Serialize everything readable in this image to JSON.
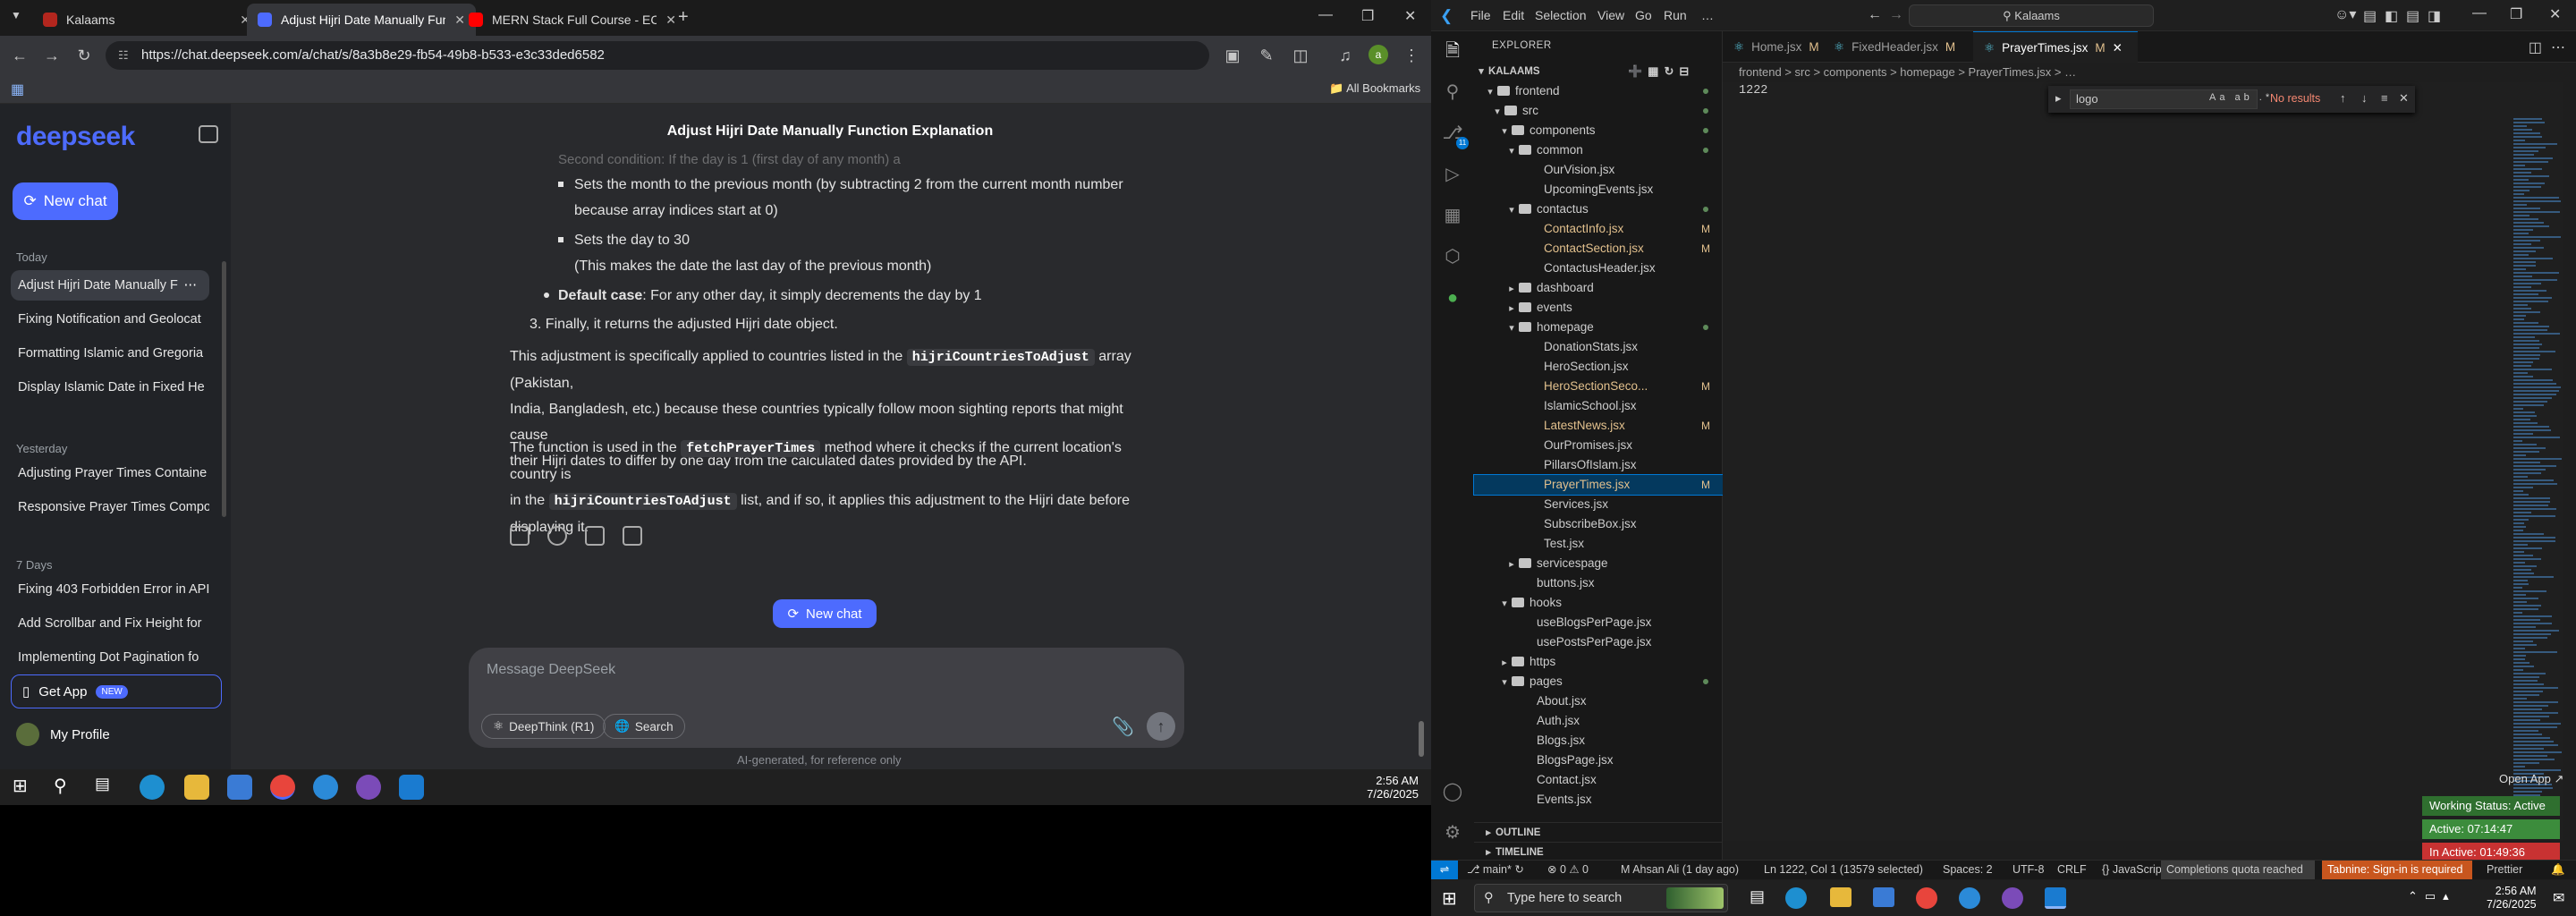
{
  "chrome": {
    "tabs": [
      {
        "title": "Kalaams",
        "favicon_color": "#b3261e",
        "active": false
      },
      {
        "title": "Adjust Hijri Date Manually Func",
        "favicon_color": "#4d6bfe",
        "active": true
      },
      {
        "title": "MERN Stack Full Course - EComm",
        "favicon_color": "#ff0000",
        "active": false
      }
    ],
    "url": "https://chat.deepseek.com/a/chat/s/8a3b8e29-fb54-49b8-b533-e3c33ded6582",
    "bookmarks_label": "All Bookmarks"
  },
  "deepseek": {
    "logo": "deepseek",
    "new_chat": "New chat",
    "sections": {
      "today": "Today",
      "yesterday": "Yesterday",
      "seven_days": "7 Days"
    },
    "chats_today": [
      "Adjust Hijri Date Manually F",
      "Fixing Notification and Geolocat",
      "Formatting Islamic and Gregoria",
      "Display Islamic Date in Fixed He"
    ],
    "chats_yesterday": [
      "Adjusting Prayer Times Containe",
      "Responsive Prayer Times Compo"
    ],
    "chats_7days": [
      "Fixing 403 Forbidden Error in API",
      "Add Scrollbar and Fix Height for",
      "Implementing Dot Pagination fo"
    ],
    "get_app": "Get App",
    "new_badge": "NEW",
    "profile": "My Profile",
    "title": "Adjust Hijri Date Manually Function Explanation",
    "content": {
      "cut_line": "Second condition: If the day is 1 (first day of any month) a",
      "bullet1_l1": "Sets the month to the previous month (by subtracting 2 from the current month number",
      "bullet1_l2": "because array indices start at 0)",
      "bullet2_l1": "Sets the day to 30",
      "bullet2_l2": "(This makes the date the last day of the previous month)",
      "default_bold": "Default case",
      "default_rest": ": For any other day, it simply decrements the day by 1",
      "step3": "3. Finally, it returns the adjusted Hijri date object.",
      "p1_a": "This adjustment is specifically applied to countries listed in the",
      "p1_code": "hijriCountriesToAdjust",
      "p1_b": "array (Pakistan,",
      "p1_l2": "India, Bangladesh, etc.) because these countries typically follow moon sighting reports that might cause",
      "p1_l3": "their Hijri dates to differ by one day from the calculated dates provided by the API.",
      "p2_a": "The function is used in the",
      "p2_code": "fetchPrayerTimes",
      "p2_b": "method where it checks if the current location's country is",
      "p2_l2a": "in the",
      "p2_code2": "hijriCountriesToAdjust",
      "p2_l2b": "list, and if so, it applies this adjustment to the Hijri date before",
      "p2_l3": "displaying it."
    },
    "float_new_chat": "New chat",
    "composer_placeholder": "Message DeepSeek",
    "deepthink": "DeepThink (R1)",
    "search": "Search",
    "disclaimer": "AI-generated, for reference only"
  },
  "taskbar_left": {
    "time": "2:56 AM",
    "date": "7/26/2025"
  },
  "vscode": {
    "menu": [
      "File",
      "Edit",
      "Selection",
      "View",
      "Go",
      "Run",
      "…"
    ],
    "command_center": "Kalaams",
    "explorer_title": "EXPLORER",
    "root": "KALAAMS",
    "tree": [
      {
        "d": 1,
        "t": "folder",
        "open": true,
        "label": "frontend",
        "dot": true
      },
      {
        "d": 2,
        "t": "folder",
        "open": true,
        "label": "src",
        "dot": true
      },
      {
        "d": 3,
        "t": "folder",
        "open": true,
        "label": "components",
        "dot": true
      },
      {
        "d": 4,
        "t": "folder",
        "open": true,
        "label": "common",
        "dot": true
      },
      {
        "d": 5,
        "t": "file",
        "label": "OurVision.jsx"
      },
      {
        "d": 5,
        "t": "file",
        "label": "UpcomingEvents.jsx"
      },
      {
        "d": 4,
        "t": "folder",
        "open": true,
        "label": "contactus",
        "dot": true
      },
      {
        "d": 5,
        "t": "file",
        "label": "ContactInfo.jsx",
        "mod": "M"
      },
      {
        "d": 5,
        "t": "file",
        "label": "ContactSection.jsx",
        "mod": "M"
      },
      {
        "d": 5,
        "t": "file",
        "label": "ContactusHeader.jsx"
      },
      {
        "d": 4,
        "t": "folder",
        "open": false,
        "label": "dashboard"
      },
      {
        "d": 4,
        "t": "folder",
        "open": false,
        "label": "events"
      },
      {
        "d": 4,
        "t": "folder",
        "open": true,
        "label": "homepage",
        "dot": true
      },
      {
        "d": 5,
        "t": "file",
        "label": "DonationStats.jsx"
      },
      {
        "d": 5,
        "t": "file",
        "label": "HeroSection.jsx"
      },
      {
        "d": 5,
        "t": "file",
        "label": "HeroSectionSeco...",
        "mod": "M"
      },
      {
        "d": 5,
        "t": "file",
        "label": "IslamicSchool.jsx"
      },
      {
        "d": 5,
        "t": "file",
        "label": "LatestNews.jsx",
        "mod": "M"
      },
      {
        "d": 5,
        "t": "file",
        "label": "OurPromises.jsx"
      },
      {
        "d": 5,
        "t": "file",
        "label": "PillarsOfIslam.jsx"
      },
      {
        "d": 5,
        "t": "file",
        "label": "PrayerTimes.jsx",
        "mod": "M",
        "sel": true
      },
      {
        "d": 5,
        "t": "file",
        "label": "Services.jsx"
      },
      {
        "d": 5,
        "t": "file",
        "label": "SubscribeBox.jsx"
      },
      {
        "d": 5,
        "t": "file",
        "label": "Test.jsx"
      },
      {
        "d": 4,
        "t": "folder",
        "open": false,
        "label": "servicespage"
      },
      {
        "d": 4,
        "t": "file",
        "label": "buttons.jsx"
      },
      {
        "d": 3,
        "t": "folder",
        "open": true,
        "label": "hooks"
      },
      {
        "d": 4,
        "t": "file",
        "label": "useBlogsPerPage.jsx"
      },
      {
        "d": 4,
        "t": "file",
        "label": "usePostsPerPage.jsx"
      },
      {
        "d": 3,
        "t": "folder",
        "open": false,
        "label": "https"
      },
      {
        "d": 3,
        "t": "folder",
        "open": true,
        "label": "pages",
        "dot": true
      },
      {
        "d": 4,
        "t": "file",
        "label": "About.jsx"
      },
      {
        "d": 4,
        "t": "file",
        "label": "Auth.jsx"
      },
      {
        "d": 4,
        "t": "file",
        "label": "Blogs.jsx"
      },
      {
        "d": 4,
        "t": "file",
        "label": "BlogsPage.jsx"
      },
      {
        "d": 4,
        "t": "file",
        "label": "Contact.jsx"
      },
      {
        "d": 4,
        "t": "file",
        "label": "Events.jsx"
      }
    ],
    "outline": "OUTLINE",
    "timeline": "TIMELINE",
    "tabs": [
      {
        "label": "Home.jsx",
        "mod": "M",
        "active": false
      },
      {
        "label": "FixedHeader.jsx",
        "mod": "M",
        "active": false
      },
      {
        "label": "PrayerTimes.jsx",
        "mod": "M",
        "active": true
      }
    ],
    "breadcrumb": "frontend > src > components > homepage > PrayerTimes.jsx > …",
    "code_line": "1222",
    "find": {
      "query": "logo",
      "result": "No results"
    },
    "status": {
      "branch": "main*",
      "errors": "⊗ 0 ⚠ 0",
      "blame": "M Ahsan Ali (1 day ago)",
      "position": "Ln 1222, Col 1 (13579 selected)",
      "spaces": "Spaces: 2",
      "encoding": "UTF-8",
      "eol": "CRLF",
      "language": "JavaScript JSX",
      "completions": "Completions quota reached",
      "tabnine": "Tabnine: Sign-in is required",
      "prettier": "Prettier"
    },
    "open_app": "Open App ↗",
    "working_status": "Working Status: Active",
    "active_time": "Active: 07:14:47",
    "inactive_time": "In Active: 01:49:36"
  },
  "taskbar_right": {
    "search_placeholder": "Type here to search",
    "time": "2:56 AM",
    "date": "7/26/2025"
  }
}
